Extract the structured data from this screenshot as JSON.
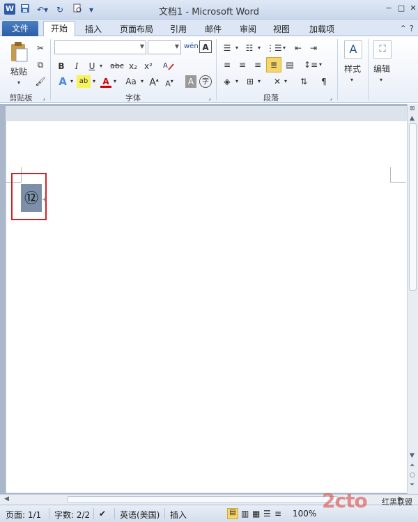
{
  "window": {
    "title": "文档1 - Microsoft Word",
    "controls": [
      "−",
      "□",
      "✕"
    ]
  },
  "quick_access": {
    "icons": [
      "word-logo-icon",
      "save-icon",
      "undo-icon",
      "redo-icon",
      "print-preview-icon",
      "customize-icon"
    ]
  },
  "tabs": {
    "file": "文件",
    "items": [
      "开始",
      "插入",
      "页面布局",
      "引用",
      "邮件",
      "审阅",
      "视图",
      "加载项"
    ],
    "active": "开始"
  },
  "ribbon": {
    "clipboard": {
      "paste": "粘贴",
      "label": "剪贴板"
    },
    "font": {
      "label": "字体",
      "font_name": "",
      "font_size": "",
      "bold": "B",
      "italic": "I",
      "underline": "U",
      "strike": "abc",
      "subscript": "x₂",
      "superscript": "x²",
      "grow": "A",
      "shrink": "A",
      "case": "Aa",
      "clear": "A",
      "phonetic": "wén",
      "enclose": "字"
    },
    "paragraph": {
      "label": "段落"
    },
    "styles": {
      "label": "样式"
    },
    "editing": {
      "label": "编辑"
    }
  },
  "document": {
    "selected_char": "⑫"
  },
  "status": {
    "page": "页面: 1/1",
    "words": "字数: 2/2",
    "language": "英语(美国)",
    "mode": "插入",
    "zoom": "100%"
  },
  "watermark": {
    "logo": "2cto",
    "site": "红黑联盟"
  },
  "colors": {
    "file_tab": "#2c5ea5",
    "selection_box": "#d32222",
    "selected_bg": "#7b8fa8",
    "highlight_btn": "#f6d56a"
  }
}
